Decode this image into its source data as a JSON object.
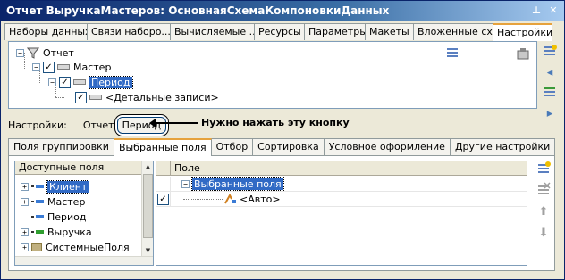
{
  "window": {
    "title": "Отчет ВыручкаМастеров: ОсновнаяСхемаКомпоновкиДанных",
    "title_buttons": [
      "pin-icon",
      "close-icon"
    ]
  },
  "top_tabs": [
    {
      "label": "Наборы данных"
    },
    {
      "label": "Связи наборо..."
    },
    {
      "label": "Вычисляемые ..."
    },
    {
      "label": "Ресурсы"
    },
    {
      "label": "Параметры"
    },
    {
      "label": "Макеты"
    },
    {
      "label": "Вложенные сх..."
    },
    {
      "label": "Настройки",
      "active": true
    }
  ],
  "structure_tree": {
    "root": "Отчет",
    "master": "Мастер",
    "period": "Период",
    "detail": "<Детальные записи>"
  },
  "settings": {
    "label": "Настройки:",
    "report_link": "Отчет",
    "period_button": "Период"
  },
  "annotation": "Нужно нажать эту кнопку",
  "sub_tabs": [
    {
      "label": "Поля группировки"
    },
    {
      "label": "Выбранные поля",
      "active": true
    },
    {
      "label": "Отбор"
    },
    {
      "label": "Сортировка"
    },
    {
      "label": "Условное оформление"
    },
    {
      "label": "Другие настройки"
    }
  ],
  "available_fields": {
    "header": "Доступные поля",
    "items": [
      "Клиент",
      "Мастер",
      "Период",
      "Выручка",
      "СистемныеПоля"
    ]
  },
  "selected_fields": {
    "header": "Поле",
    "group": "Выбранные поля",
    "auto": "<Авто>"
  },
  "colors": {
    "selection": "#316ac5",
    "title_bar": "#0a246a",
    "active_tab_accent": "#e6a23c"
  }
}
